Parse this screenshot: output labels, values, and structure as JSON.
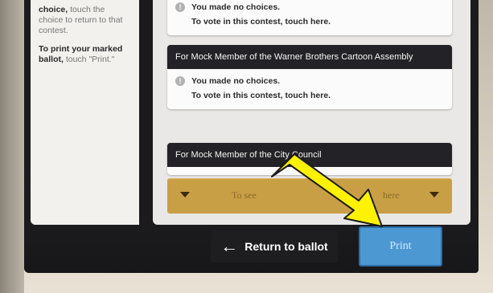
{
  "instructions": {
    "p1_bold": "choice,",
    "p1_rest": " touch the choice to return to that contest.",
    "p2_bold": "To print your marked ballot,",
    "p2_rest": " touch \"Print.\""
  },
  "contests": [
    {
      "title": "",
      "status": "You made no choices.",
      "action": "To vote in this contest, touch here."
    },
    {
      "title": "For Mock Member of the Warner Brothers Cartoon Assembly",
      "status": "You made no choices.",
      "action": "To vote in this contest, touch here."
    },
    {
      "title": "For Mock Member of the City Council",
      "status": "",
      "action": ""
    }
  ],
  "scroll": {
    "text": "To see",
    "text_tail": "here"
  },
  "footer": {
    "return_label": "Return to ballot",
    "print_label": "Print"
  },
  "colors": {
    "screen": "#1b1b1d",
    "card_header": "#232327",
    "scroll_bar": "#c99f45",
    "print_button": "#4c98d3",
    "callout_arrow": "#fff200"
  },
  "icons": [
    "info-icon",
    "left-arrow-icon",
    "chevron-down-icon",
    "callout-arrow-icon"
  ]
}
